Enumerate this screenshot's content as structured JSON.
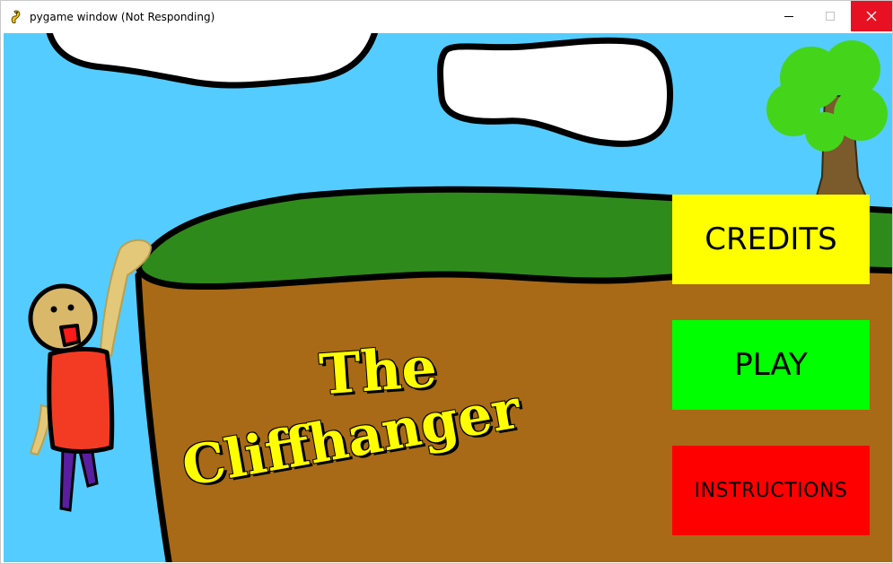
{
  "window": {
    "title": "pygame window (Not Responding)",
    "icon": "pygame-snake-icon",
    "controls": {
      "minimize_icon": "minimize-icon",
      "maximize_icon": "maximize-icon",
      "close_icon": "close-icon"
    }
  },
  "game": {
    "title_line1": "The",
    "title_line2": "Cliffhanger",
    "buttons": {
      "credits": "CREDITS",
      "play": "PLAY",
      "instructions": "INSTRUCTIONS"
    },
    "colors": {
      "sky": "#55ccff",
      "grass": "#2f8a1c",
      "dirt": "#a86a16",
      "title_text": "#ffff00",
      "credits_button": "#ffff00",
      "play_button": "#00ff00",
      "instructions_button": "#ff0000",
      "close_button": "#e81123"
    }
  }
}
